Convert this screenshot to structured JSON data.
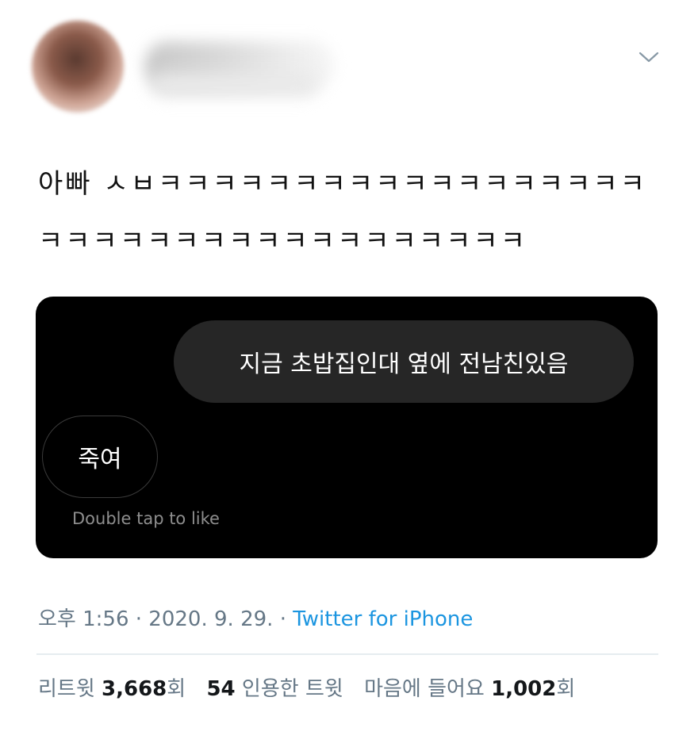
{
  "tweet": {
    "text": "아빠 ㅅㅂㅋㅋㅋㅋㅋㅋㅋㅋㅋㅋㅋㅋㅋㅋㅋㅋㅋㅋㅋㅋㅋㅋㅋㅋㅋㅋㅋㅋㅋㅋㅋㅋㅋㅋㅋㅋ",
    "icons": {
      "menu": "chevron-down-icon"
    }
  },
  "media": {
    "outgoing_message": "지금 초밥집인대 옆에 전남친있음",
    "incoming_message": "죽여",
    "hint": "Double tap to like"
  },
  "meta": {
    "time": "오후 1:56",
    "separator": "·",
    "date": "2020. 9. 29.",
    "source": "Twitter for iPhone"
  },
  "stats": {
    "retweet_label": "리트윗",
    "retweet_count": "3,668",
    "retweet_suffix": "회",
    "quote_count": "54",
    "quote_label": "인용한 트윗",
    "like_label": "마음에 들어요",
    "like_count": "1,002",
    "like_suffix": "회"
  },
  "colors": {
    "meta_text": "#657786",
    "link": "#1b95e0",
    "media_bg": "#000000",
    "bubble": "#262626"
  }
}
